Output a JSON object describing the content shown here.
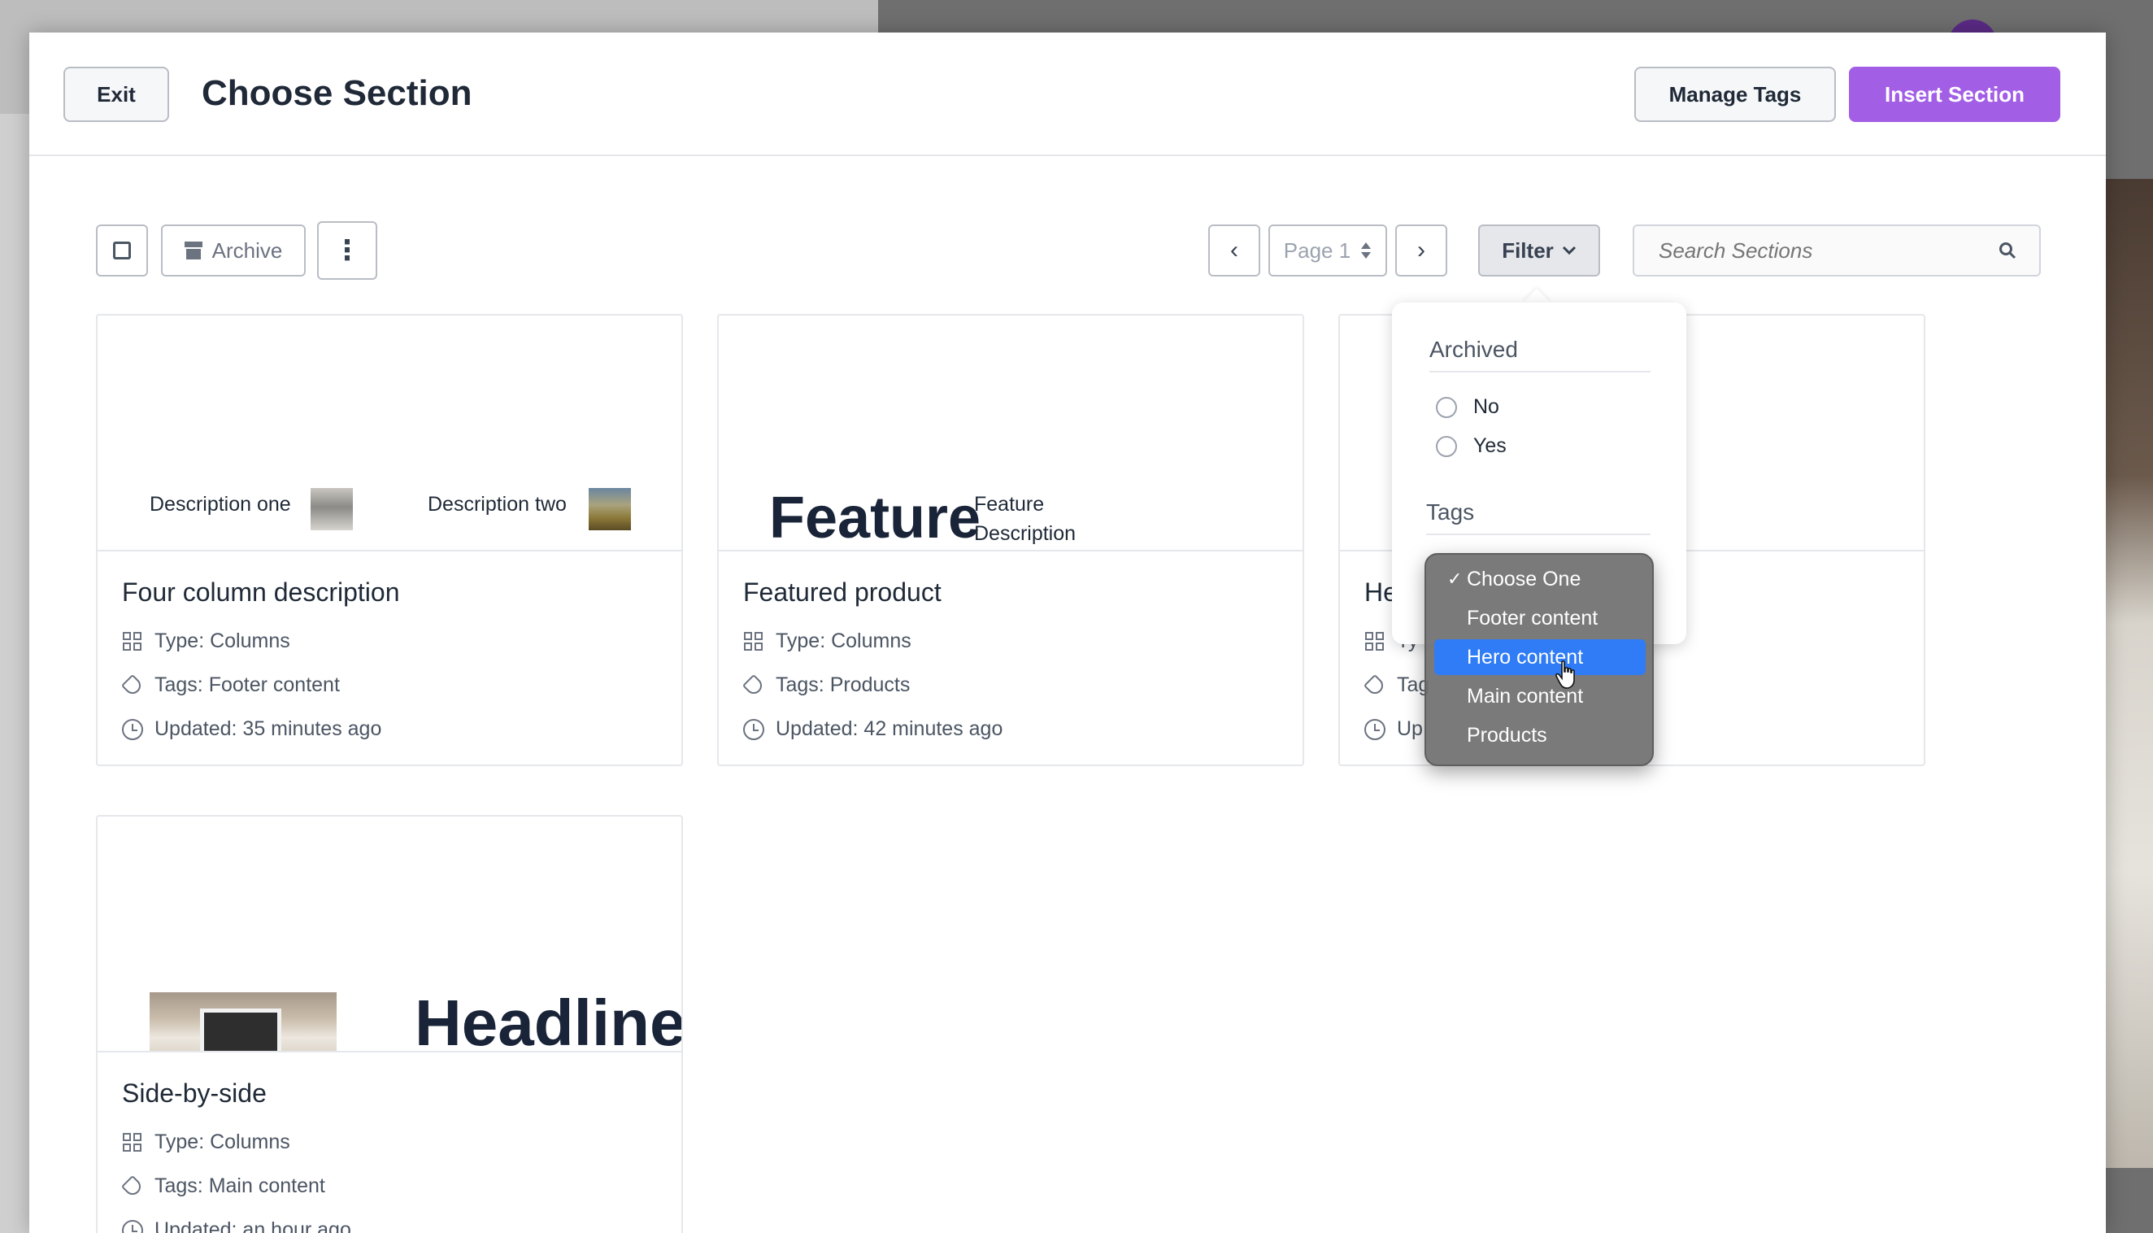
{
  "header": {
    "exit_label": "Exit",
    "title": "Choose Section",
    "manage_tags_label": "Manage Tags",
    "insert_section_label": "Insert Section"
  },
  "toolbar": {
    "archive_label": "Archive",
    "more_label": "⋮",
    "prev_label": "‹",
    "page_label": "Page 1",
    "next_label": "›",
    "filter_label": "Filter",
    "search_placeholder": "Search Sections"
  },
  "cards": [
    {
      "title": "Four column description",
      "type": "Type: Columns",
      "tags": "Tags: Footer content",
      "updated": "Updated: 35 minutes ago",
      "preview": {
        "desc_one": "Description one",
        "desc_two": "Description two"
      }
    },
    {
      "title": "Featured product",
      "type": "Type: Columns",
      "tags": "Tags: Products",
      "updated": "Updated: 42 minutes ago",
      "preview": {
        "feature": "Feature",
        "feature_desc": "Feature Description"
      }
    },
    {
      "title": "He",
      "type": "Ty",
      "tags": "Tag",
      "updated": "Up"
    },
    {
      "title": "Side-by-side",
      "type": "Type: Columns",
      "tags": "Tags: Main content",
      "updated": "Updated: an hour ago",
      "preview": {
        "headline": "Headline"
      }
    }
  ],
  "filter_popover": {
    "archived_heading": "Archived",
    "archived_options": [
      "No",
      "Yes"
    ],
    "tags_heading": "Tags"
  },
  "tags_select": {
    "options": [
      "Choose One",
      "Footer content",
      "Hero content",
      "Main content",
      "Products"
    ],
    "checked": "Choose One",
    "highlighted": "Hero content"
  },
  "colors": {
    "accent": "#a35ee6",
    "highlight": "#2f7cf6"
  }
}
